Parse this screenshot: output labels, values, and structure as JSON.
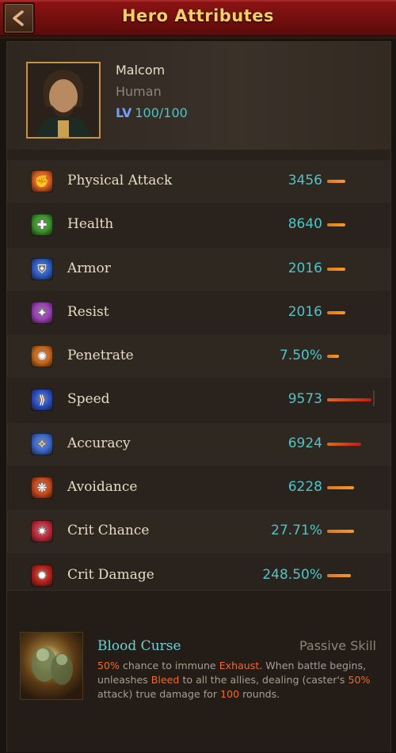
{
  "header": {
    "title": "Hero Attributes",
    "back_icon": "chevron-left-icon",
    "bg_color": "#7a1010",
    "title_color": "#f3cf6a"
  },
  "hero": {
    "name": "Malcom",
    "race": "Human",
    "level_tag": "LV",
    "level": "100/100"
  },
  "attributes": [
    {
      "label": "Physical Attack",
      "value": "3456",
      "icon": "fist-fire-icon",
      "icon_color": "#e06020",
      "bar_fill": 0.37,
      "high": false
    },
    {
      "label": "Health",
      "value": "8640",
      "icon": "health-icon",
      "icon_color": "#3a9a2a",
      "bar_fill": 0.37,
      "high": false
    },
    {
      "label": "Armor",
      "value": "2016",
      "icon": "shield-icon",
      "icon_color": "#2a60d0",
      "bar_fill": 0.37,
      "high": false
    },
    {
      "label": "Resist",
      "value": "2016",
      "icon": "resist-icon",
      "icon_color": "#a040c0",
      "bar_fill": 0.37,
      "high": false
    },
    {
      "label": "Penetrate",
      "value": "7.50%",
      "icon": "penetrate-icon",
      "icon_color": "#d06a18",
      "bar_fill": 0.24,
      "high": false
    },
    {
      "label": "Speed",
      "value": "9573",
      "icon": "speed-icon",
      "icon_color": "#2a50d0",
      "bar_fill": 0.91,
      "high": true
    },
    {
      "label": "Accuracy",
      "value": "6924",
      "icon": "accuracy-icon",
      "icon_color": "#3a6ad8",
      "bar_fill": 0.69,
      "high": true
    },
    {
      "label": "Avoidance",
      "value": "6228",
      "icon": "avoidance-icon",
      "icon_color": "#d04a18",
      "bar_fill": 0.55,
      "high": false
    },
    {
      "label": "Crit Chance",
      "value": "27.71%",
      "icon": "crit-chance-icon",
      "icon_color": "#c8283a",
      "bar_fill": 0.55,
      "high": false
    },
    {
      "label": "Crit Damage",
      "value": "248.50%",
      "icon": "crit-damage-icon",
      "icon_color": "#c0201a",
      "bar_fill": 0.48,
      "high": false
    }
  ],
  "skill": {
    "name": "Blood Curse",
    "type": "Passive Skill",
    "desc_parts": [
      {
        "text": "50%",
        "hl": true
      },
      {
        "text": " chance to immune ",
        "hl": false
      },
      {
        "text": "Exhaust",
        "hl": true
      },
      {
        "text": ". When battle begins, unleashes ",
        "hl": false
      },
      {
        "text": "Bleed",
        "hl": true
      },
      {
        "text": " to all the allies, dealing (caster's ",
        "hl": false
      },
      {
        "text": "50%",
        "hl": true
      },
      {
        "text": " attack) true damage for ",
        "hl": false
      },
      {
        "text": "100",
        "hl": true
      },
      {
        "text": " rounds.",
        "hl": false
      }
    ]
  }
}
